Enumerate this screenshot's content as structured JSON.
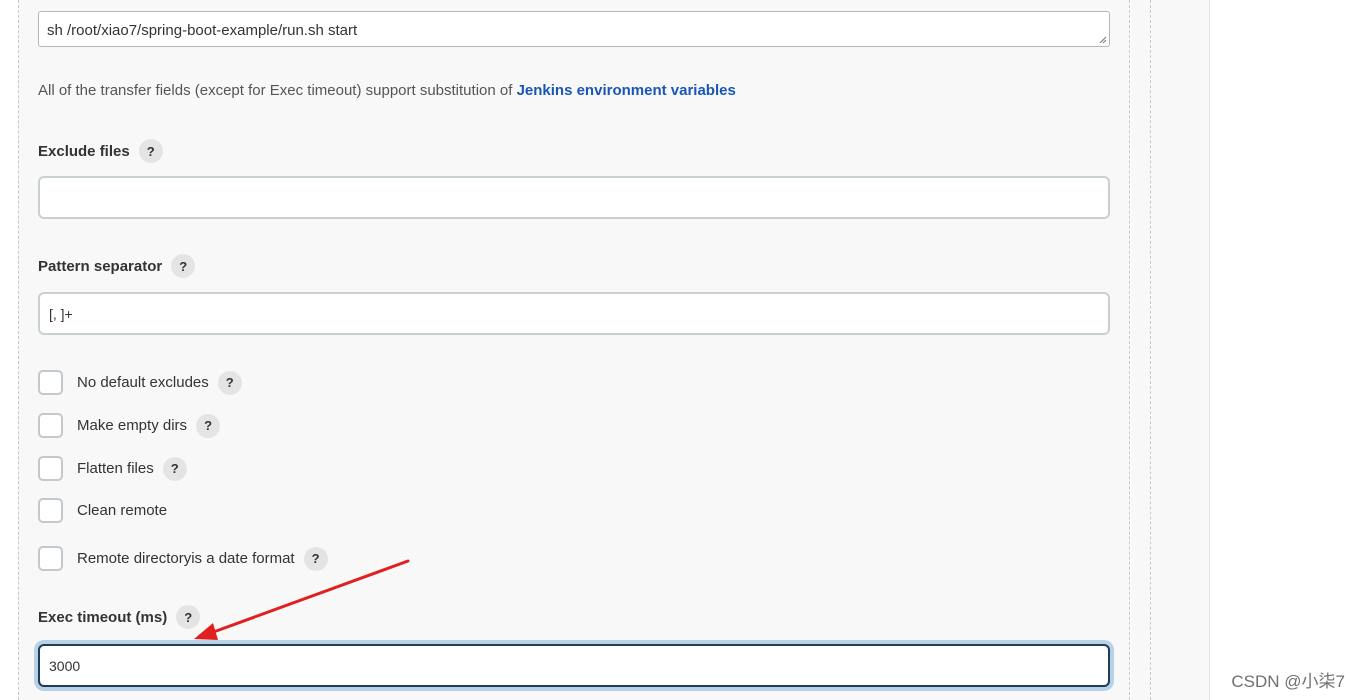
{
  "exec_command": {
    "value": "sh /root/xiao7/spring-boot-example/run.sh start"
  },
  "transfer_info": {
    "text": "All of the transfer fields (except for Exec timeout) support substitution of ",
    "link_label": "Jenkins environment variables"
  },
  "exclude_files": {
    "label": "Exclude files",
    "value": ""
  },
  "pattern_separator": {
    "label": "Pattern separator",
    "value": "[, ]+"
  },
  "checkboxes": [
    {
      "label": "No default excludes",
      "checked": false,
      "has_help": true
    },
    {
      "label": "Make empty dirs",
      "checked": false,
      "has_help": true
    },
    {
      "label": "Flatten files",
      "checked": false,
      "has_help": true
    },
    {
      "label": "Clean remote",
      "checked": false,
      "has_help": false
    },
    {
      "label": "Remote directoryis a date format",
      "checked": false,
      "has_help": true
    }
  ],
  "exec_timeout": {
    "label": "Exec timeout (ms)",
    "value": "3000"
  },
  "help_glyph": "?",
  "watermark": "CSDN @小柒7",
  "colors": {
    "link": "#1a56b7",
    "focus_border": "#1d3d57",
    "focus_ring": "#b9d1e6",
    "annotation_arrow": "#e02020"
  }
}
